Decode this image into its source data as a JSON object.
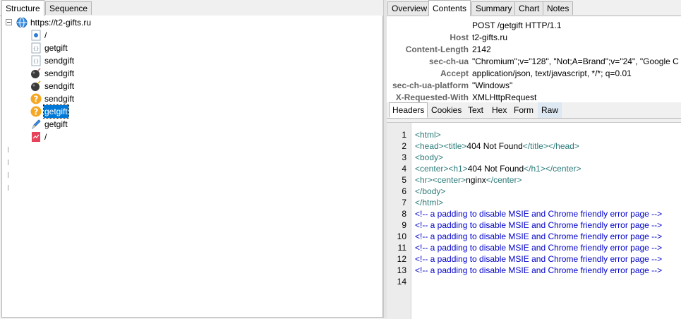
{
  "left_tabs": [
    "Structure",
    "Sequence"
  ],
  "tree": [
    {
      "label": "https://t2-gifts.ru",
      "icon": "globe-icon"
    },
    {
      "label": "/",
      "icon": "folder-icon"
    },
    {
      "label": "getgift",
      "icon": "file-icon"
    },
    {
      "label": "sendgift",
      "icon": "file-icon"
    },
    {
      "label": "sendgift",
      "icon": "bomb-icon"
    },
    {
      "label": "sendgift",
      "icon": "bomb-icon"
    },
    {
      "label": "sendgift",
      "icon": "question-icon"
    },
    {
      "label": "getgift",
      "icon": "question-icon",
      "selected": true
    },
    {
      "label": "getgift",
      "icon": "pen-icon"
    },
    {
      "label": "/",
      "icon": "error-icon"
    }
  ],
  "right_tabs": [
    "Overview",
    "Contents",
    "Summary",
    "Chart",
    "Notes"
  ],
  "request_line": "POST /getgift HTTP/1.1",
  "headers": [
    {
      "name": "Host",
      "value": "t2-gifts.ru"
    },
    {
      "name": "Content-Length",
      "value": "2142"
    },
    {
      "name": "sec-ch-ua",
      "value": "\"Chromium\";v=\"128\", \"Not;A=Brand\";v=\"24\", \"Google C"
    },
    {
      "name": "Accept",
      "value": "application/json, text/javascript, */*; q=0.01"
    },
    {
      "name": "sec-ch-ua-platform",
      "value": "\"Windows\""
    },
    {
      "name": "X-Requested-With",
      "value": "XMLHttpRequest"
    }
  ],
  "sub_tabs": [
    "Headers",
    "Cookies",
    "Text",
    "Hex",
    "Form",
    "Raw"
  ],
  "code_lines": [
    {
      "n": "1",
      "parts": [
        [
          "tg",
          "<html>"
        ]
      ]
    },
    {
      "n": "2",
      "parts": [
        [
          "tg",
          "<head><title>"
        ],
        [
          "tx",
          "404 Not Found"
        ],
        [
          "tg",
          "</title></head>"
        ]
      ]
    },
    {
      "n": "3",
      "parts": [
        [
          "tg",
          "<body>"
        ]
      ]
    },
    {
      "n": "4",
      "parts": [
        [
          "tg",
          "<center><h1>"
        ],
        [
          "tx",
          "404 Not Found"
        ],
        [
          "tg",
          "</h1></center>"
        ]
      ]
    },
    {
      "n": "5",
      "parts": [
        [
          "tg",
          "<hr><center>"
        ],
        [
          "tx",
          "nginx"
        ],
        [
          "tg",
          "</center>"
        ]
      ]
    },
    {
      "n": "6",
      "parts": [
        [
          "tg",
          "</body>"
        ]
      ]
    },
    {
      "n": "7",
      "parts": [
        [
          "tg",
          "</html>"
        ]
      ]
    },
    {
      "n": "8",
      "parts": [
        [
          "cm",
          "<!-- a padding to disable MSIE and Chrome friendly error page -->"
        ]
      ]
    },
    {
      "n": "9",
      "parts": [
        [
          "cm",
          "<!-- a padding to disable MSIE and Chrome friendly error page -->"
        ]
      ]
    },
    {
      "n": "10",
      "parts": [
        [
          "cm",
          "<!-- a padding to disable MSIE and Chrome friendly error page -->"
        ]
      ]
    },
    {
      "n": "11",
      "parts": [
        [
          "cm",
          "<!-- a padding to disable MSIE and Chrome friendly error page -->"
        ]
      ]
    },
    {
      "n": "12",
      "parts": [
        [
          "cm",
          "<!-- a padding to disable MSIE and Chrome friendly error page -->"
        ]
      ]
    },
    {
      "n": "13",
      "parts": [
        [
          "cm",
          "<!-- a padding to disable MSIE and Chrome friendly error page -->"
        ]
      ]
    },
    {
      "n": "14",
      "parts": []
    }
  ],
  "colors": {
    "selection": "#0078d7",
    "tag": "#2b7a78",
    "comment": "#0000cc",
    "header_name": "#666666"
  }
}
